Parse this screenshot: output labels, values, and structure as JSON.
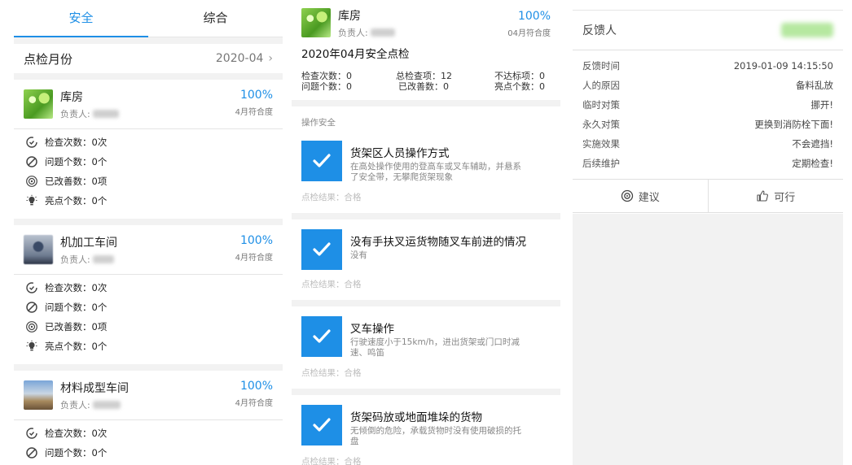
{
  "left_panel": {
    "tabs": [
      {
        "label": "安全",
        "active": true
      },
      {
        "label": "综合",
        "active": false
      }
    ],
    "month_label": "点检月份",
    "month_value": "2020-04",
    "cards": [
      {
        "title": "库房",
        "owner_label": "负责人:",
        "rate": "100%",
        "rate_label": "4月符合度",
        "stats": [
          {
            "icon": "refresh-check-icon",
            "text": "检查次数：0次"
          },
          {
            "icon": "ban-icon",
            "text": "问题个数：0个"
          },
          {
            "icon": "target-icon",
            "text": "已改善数：0项"
          },
          {
            "icon": "bulb-icon",
            "text": "亮点个数：0个"
          }
        ]
      },
      {
        "title": "机加工车间",
        "owner_label": "负责人:",
        "rate": "100%",
        "rate_label": "4月符合度",
        "stats": [
          {
            "icon": "refresh-check-icon",
            "text": "检查次数：0次"
          },
          {
            "icon": "ban-icon",
            "text": "问题个数：0个"
          },
          {
            "icon": "target-icon",
            "text": "已改善数：0项"
          },
          {
            "icon": "bulb-icon",
            "text": "亮点个数：0个"
          }
        ]
      },
      {
        "title": "材料成型车间",
        "owner_label": "负责人:",
        "rate": "100%",
        "rate_label": "4月符合度",
        "stats": [
          {
            "icon": "refresh-check-icon",
            "text": "检查次数：0次"
          },
          {
            "icon": "ban-icon",
            "text": "问题个数：0个"
          }
        ]
      }
    ]
  },
  "middle_panel": {
    "title": "库房",
    "owner_label": "负责人:",
    "rate": "100%",
    "rate_label": "04月符合度",
    "heading": "2020年04月安全点检",
    "stats": {
      "check_count": "检查次数：0",
      "total_items": "总检查项：12",
      "not_met": "不达标项：0",
      "problem_count": "问题个数：0",
      "improved": "已改善数：0",
      "highlights": "亮点个数：0"
    },
    "section": "操作安全",
    "items": [
      {
        "title": "货架区人员操作方式",
        "desc": "在高处操作使用的登高车或叉车辅助，并悬系了安全带，无攀爬货架现象",
        "result": "点检结果：合格"
      },
      {
        "title": "没有手扶叉运货物随叉车前进的情况",
        "desc": "没有",
        "result": "点检结果：合格"
      },
      {
        "title": "叉车操作",
        "desc": "行驶速度小于15km/h，进出货架或门口时减速、鸣笛",
        "result": "点检结果：合格"
      },
      {
        "title": "货架码放或地面堆垛的货物",
        "desc": "无倾倒的危险，承载货物时没有使用破损的托盘",
        "result": "点检结果：合格"
      }
    ]
  },
  "right_panel": {
    "feedback_label": "反馈人",
    "rows": [
      {
        "key": "反馈时间",
        "value": "2019-01-09 14:15:50"
      },
      {
        "key": "人的原因",
        "value": "备料乱放"
      },
      {
        "key": "临时对策",
        "value": "挪开!"
      },
      {
        "key": "永久对策",
        "value": "更换到消防栓下面!"
      },
      {
        "key": "实施效果",
        "value": "不会遮挡!"
      },
      {
        "key": "后续维护",
        "value": "定期检查!"
      }
    ],
    "actions": [
      {
        "icon": "suggest-icon",
        "label": "建议"
      },
      {
        "icon": "thumbs-up-icon",
        "label": "可行"
      }
    ]
  },
  "colors": {
    "accent": "#1e8fe6",
    "muted": "#888888"
  }
}
